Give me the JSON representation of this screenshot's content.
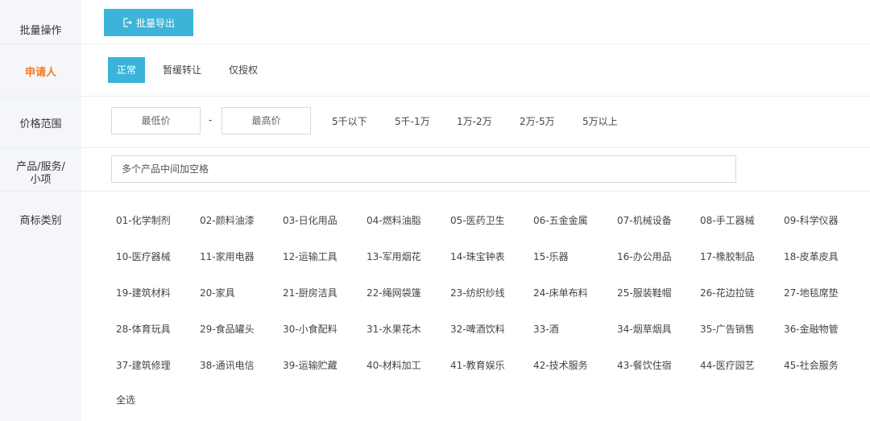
{
  "batch": {
    "label": "批量操作",
    "export_label": "批量导出",
    "export_icon": "export-icon"
  },
  "applicant": {
    "label": "申请人",
    "tabs": [
      "正常",
      "暂缓转让",
      "仅授权"
    ],
    "active": 0
  },
  "price": {
    "label": "价格范围",
    "min_placeholder": "最低价",
    "max_placeholder": "最高价",
    "separator": "-",
    "ranges": [
      "5千以下",
      "5千-1万",
      "1万-2万",
      "2万-5万",
      "5万以上"
    ]
  },
  "product": {
    "label_line1": "产品/服务/",
    "label_line2": "小项",
    "placeholder": "多个产品中间加空格"
  },
  "category": {
    "label": "商标类别",
    "items": [
      "01-化学制剂",
      "02-颜料油漆",
      "03-日化用品",
      "04-燃料油脂",
      "05-医药卫生",
      "06-五金金属",
      "07-机械设备",
      "08-手工器械",
      "09-科学仪器",
      "10-医疗器械",
      "11-家用电器",
      "12-运输工具",
      "13-军用烟花",
      "14-珠宝钟表",
      "15-乐器",
      "16-办公用品",
      "17-橡胶制品",
      "18-皮革皮具",
      "19-建筑材料",
      "20-家具",
      "21-厨房洁具",
      "22-绳网袋篷",
      "23-纺织纱线",
      "24-床单布料",
      "25-服装鞋帽",
      "26-花边拉链",
      "27-地毯席垫",
      "28-体育玩具",
      "29-食品罐头",
      "30-小食配料",
      "31-水果花木",
      "32-啤酒饮料",
      "33-酒",
      "34-烟草烟具",
      "35-广告销售",
      "36-金融物管",
      "37-建筑修理",
      "38-通讯电信",
      "39-运输贮藏",
      "40-材料加工",
      "41-教育娱乐",
      "42-技术服务",
      "43-餐饮住宿",
      "44-医疗园艺",
      "45-社会服务"
    ],
    "select_all": "全选"
  },
  "colors": {
    "accent": "#3cb4d9",
    "label_highlight": "#f27b22",
    "sidebar_bg": "#f4f6fa"
  }
}
